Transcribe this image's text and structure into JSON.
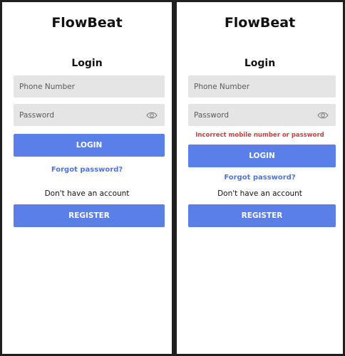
{
  "app_title": "FlowBeat",
  "screens": [
    {
      "heading": "Login",
      "phone_placeholder": "Phone Number",
      "password_placeholder": "Password",
      "password_icon": "eye-icon",
      "error": "",
      "login_label": "LOGIN",
      "forgot_label": "Forgot password?",
      "no_account_text": "Don't have an account",
      "register_label": "REGISTER"
    },
    {
      "heading": "Login",
      "phone_placeholder": "Phone Number",
      "password_placeholder": "Password",
      "password_icon": "eye-icon",
      "error": "Incorrect mobile number or password",
      "login_label": "LOGIN",
      "forgot_label": "Forgot password?",
      "no_account_text": "Don't have an account",
      "register_label": "REGISTER"
    }
  ],
  "colors": {
    "primary": "#5b7fe9",
    "link": "#4e74e0",
    "error": "#d83b3b",
    "field_bg": "#e5e5e5"
  }
}
